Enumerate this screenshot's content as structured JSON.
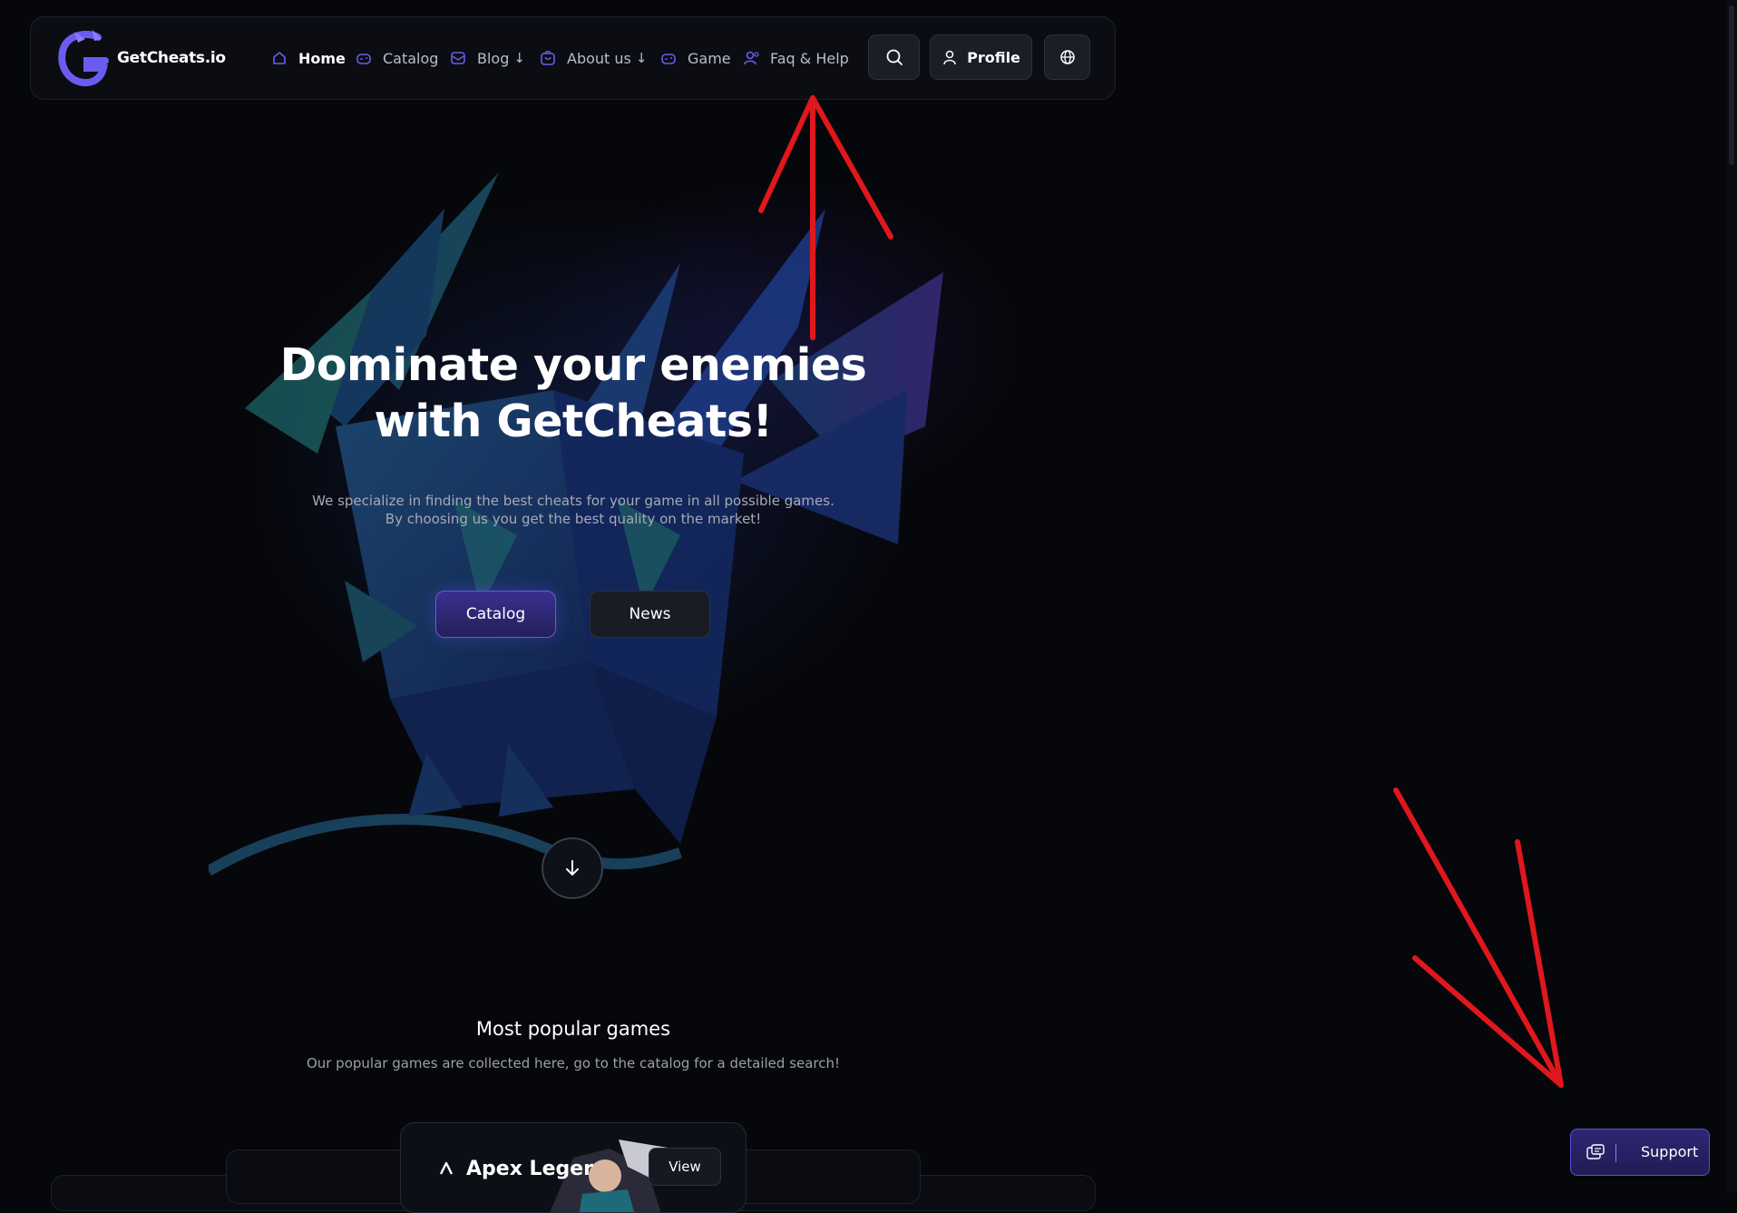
{
  "brand": {
    "name": "GetCheats.io"
  },
  "nav": {
    "items": [
      {
        "label": "Home",
        "icon": "home-icon",
        "active": true
      },
      {
        "label": "Catalog",
        "icon": "gamepad-icon"
      },
      {
        "label": "Blog",
        "icon": "mail-icon",
        "arrow": "↓"
      },
      {
        "label": "About us",
        "icon": "shopping-bag-icon",
        "arrow": "↓"
      },
      {
        "label": "Game",
        "icon": "gamepad-icon"
      },
      {
        "label": "Faq & Help",
        "icon": "user-help-icon"
      }
    ],
    "search_icon": "search-icon",
    "profile_label": "Profile",
    "language_icon": "globe-icon"
  },
  "hero": {
    "title_line1": "Dominate your enemies",
    "title_line2": "with GetCheats!",
    "subtitle_line1": "We specialize in finding the best cheats for your game in all possible games.",
    "subtitle_line2": "By choosing us you get the best quality on the market!",
    "catalog_label": "Catalog",
    "news_label": "News"
  },
  "popular": {
    "title": "Most popular games",
    "subtitle": "Our popular games are collected here, go to the catalog for a detailed search!",
    "card": {
      "name": "Apex Leger",
      "view_label": "View"
    }
  },
  "support": {
    "label": "Support"
  },
  "colors": {
    "background": "#06070b",
    "accent": "#6a58e0",
    "annotation": "#e0171c"
  }
}
